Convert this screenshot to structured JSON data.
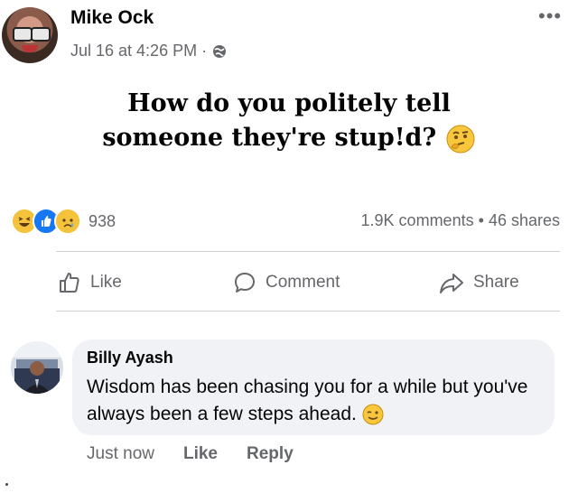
{
  "post": {
    "author": "Mike Ock",
    "timestamp": "Jul 16 at 4:26 PM ·",
    "privacy_icon": "globe-icon",
    "more_label": "•••",
    "text_line1": "How do you politely tell",
    "text_line2": "someone they're stup!d?",
    "emoji": "thinking-face"
  },
  "reactions": {
    "types": [
      "haha",
      "like",
      "sad"
    ],
    "count": "938",
    "comments": "1.9K comments",
    "separator": "•",
    "shares": "46 shares"
  },
  "actions": {
    "like": "Like",
    "comment": "Comment",
    "share": "Share"
  },
  "comment": {
    "author": "Billy Ayash",
    "text": "Wisdom has been chasing you for a while but you've always been a few steps ahead.",
    "emoji": "winking-face",
    "time": "Just now",
    "like": "Like",
    "reply": "Reply"
  },
  "colors": {
    "secondary_text": "#65676b",
    "bubble": "#f0f2f5",
    "like_blue": "#1877f2",
    "reaction_yellow": "#f5c33b"
  }
}
